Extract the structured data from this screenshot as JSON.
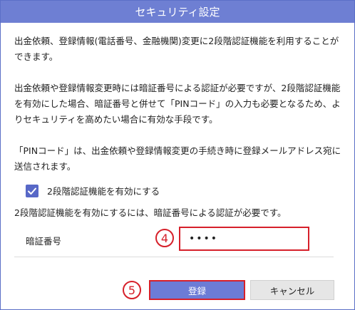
{
  "dialog": {
    "title": "セキュリティ設定",
    "paragraph1": "出金依頼、登録情報(電話番号、金融機関)変更に2段階認証機能を利用することができます。",
    "paragraph2": "出金依頼や登録情報変更時には暗証番号による認証が必要ですが、2段階認証機能を有効にした場合、暗証番号と併せて「PINコード」の入力も必要となるため、よりセキュリティを高めたい場合に有効な手段です。",
    "paragraph3": "「PINコード」は、出金依頼や登録情報変更の手続き時に登録メールアドレス宛に送信されます。",
    "checkbox": {
      "label": "2段階認証機能を有効にする",
      "checked": true
    },
    "hint": "2段階認証機能を有効にするには、暗証番号による認証が必要です。",
    "pin": {
      "label": "暗証番号",
      "value": "••••"
    },
    "badge4": "4",
    "badge5": "5",
    "buttons": {
      "register": "登録",
      "cancel": "キャンセル"
    }
  },
  "colors": {
    "titlebar": "#6e7fd3",
    "primary": "#6c7cd6",
    "highlight": "#d6202a",
    "checkbox": "#5868c7"
  }
}
